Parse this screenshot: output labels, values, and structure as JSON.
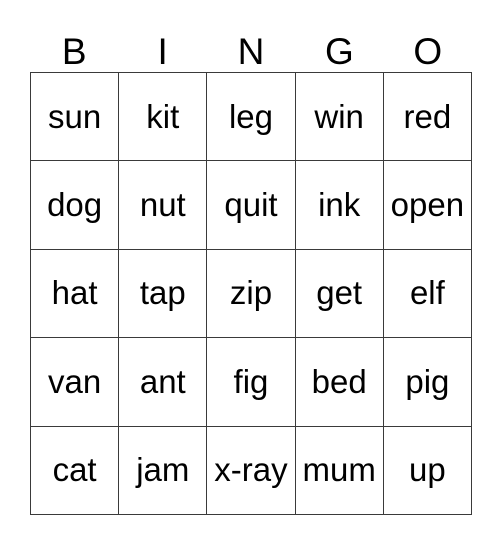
{
  "card": {
    "headers": [
      "B",
      "I",
      "N",
      "G",
      "O"
    ],
    "rows": [
      [
        "sun",
        "kit",
        "leg",
        "win",
        "red"
      ],
      [
        "dog",
        "nut",
        "quit",
        "ink",
        "open"
      ],
      [
        "hat",
        "tap",
        "zip",
        "get",
        "elf"
      ],
      [
        "van",
        "ant",
        "fig",
        "bed",
        "pig"
      ],
      [
        "cat",
        "jam",
        "x-ray",
        "mum",
        "up"
      ]
    ],
    "colors": {
      "background": "#ffffff",
      "text": "#000000",
      "border": "#3a3a3a"
    }
  }
}
